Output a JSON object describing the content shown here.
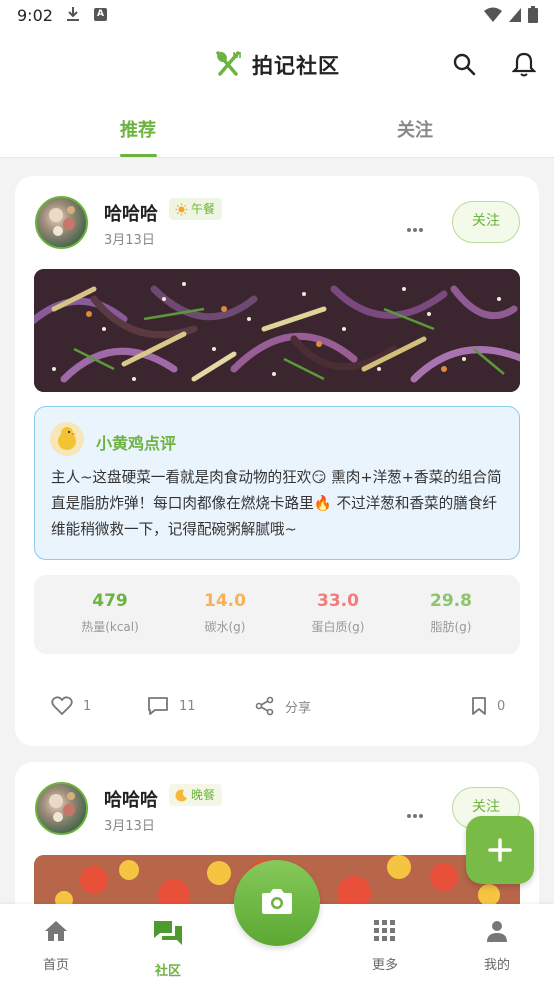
{
  "status_bar": {
    "time": "9:02",
    "a_badge": "A"
  },
  "header": {
    "title": "拍记社区"
  },
  "tabs": [
    {
      "label": "推荐",
      "active": true
    },
    {
      "label": "关注",
      "active": false
    }
  ],
  "posts": [
    {
      "user": "哈哈哈",
      "meal": {
        "icon": "sun-icon",
        "label": "午餐"
      },
      "date": "3月13日",
      "follow_label": "关注",
      "ai_review": {
        "title": "小黄鸡点评",
        "text": "主人~这盘硬菜一看就是肉食动物的狂欢😏 熏肉+洋葱+香菜的组合简直是脂肪炸弹！每口肉都像在燃烧卡路里🔥 不过洋葱和香菜的膳食纤维能稍微救一下，记得配碗粥解腻哦~"
      },
      "nutrition": [
        {
          "value": "479",
          "label": "热量(kcal)",
          "color": "#6db33f"
        },
        {
          "value": "14.0",
          "label": "碳水(g)",
          "color": "#f5b25a"
        },
        {
          "value": "33.0",
          "label": "蛋白质(g)",
          "color": "#f07c7c"
        },
        {
          "value": "29.8",
          "label": "脂肪(g)",
          "color": "#8cc56a"
        }
      ],
      "actions": {
        "likes": "1",
        "comments": "11",
        "share_label": "分享",
        "bookmarks": "0"
      }
    },
    {
      "user": "哈哈哈",
      "meal": {
        "icon": "moon-icon",
        "label": "晚餐"
      },
      "date": "3月13日",
      "follow_label": "关注"
    }
  ],
  "bottom_nav": [
    {
      "label": "首页",
      "icon": "home-icon",
      "active": false
    },
    {
      "label": "社区",
      "icon": "chat-icon",
      "active": true
    },
    {
      "label": "更多",
      "icon": "grid-icon",
      "active": false
    },
    {
      "label": "我的",
      "icon": "person-icon",
      "active": false
    }
  ],
  "colors": {
    "accent": "#6db33f",
    "ai_border": "#8ccaf0",
    "ai_bg": "#eaf4fd"
  }
}
